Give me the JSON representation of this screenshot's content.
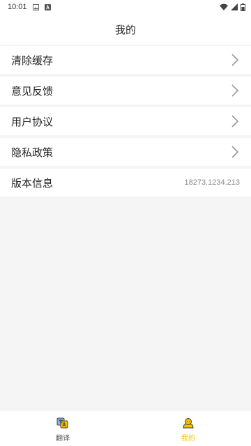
{
  "status_bar": {
    "time": "10:01"
  },
  "header": {
    "title": "我的"
  },
  "menu": {
    "items": [
      {
        "label": "清除缓存"
      },
      {
        "label": "意见反馈"
      },
      {
        "label": "用户协议"
      },
      {
        "label": "隐私政策"
      }
    ],
    "version": {
      "label": "版本信息",
      "value": "18273.1234.213"
    }
  },
  "bottom_nav": {
    "items": [
      {
        "label": "翻译",
        "icon": "translate-icon"
      },
      {
        "label": "我的",
        "icon": "profile-icon",
        "active": true
      }
    ]
  },
  "colors": {
    "accent": "#f5c300",
    "background": "#f5f5f5",
    "surface": "#ffffff"
  }
}
